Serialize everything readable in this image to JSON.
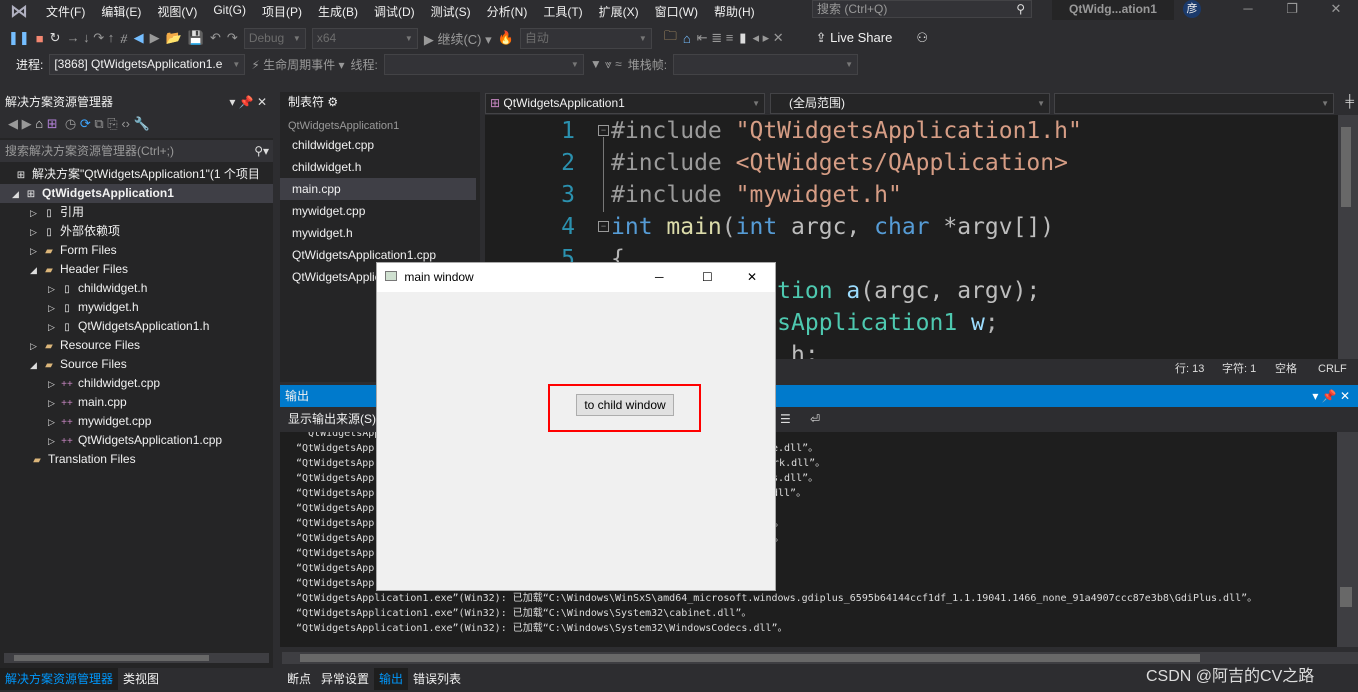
{
  "menu": [
    "文件(F)",
    "编辑(E)",
    "视图(V)",
    "Git(G)",
    "项目(P)",
    "生成(B)",
    "调试(D)",
    "测试(S)",
    "分析(N)",
    "工具(T)",
    "扩展(X)",
    "窗口(W)",
    "帮助(H)"
  ],
  "search_placeholder": "搜索 (Ctrl+Q)",
  "window_title": "QtWidg...ation1",
  "avatar": "彦",
  "toolbar": {
    "config": "Debug",
    "platform": "x64",
    "continue": "继续(C)",
    "auto": "自动",
    "live_share": "Live Share"
  },
  "debugbar": {
    "process_label": "进程:",
    "process": "[3868] QtWidgetsApplication1.e",
    "lifecycle": "生命周期事件",
    "thread_label": "线程:",
    "stack_label": "堆栈帧:"
  },
  "solution": {
    "title": "解决方案资源管理器",
    "search_placeholder": "搜索解决方案资源管理器(Ctrl+;)",
    "items": [
      {
        "label": "解决方案\"QtWidgetsApplication1\"(1 个项目",
        "level": 0,
        "arrow": ""
      },
      {
        "label": "QtWidgetsApplication1",
        "level": 0,
        "arrow": "open",
        "bold": true
      },
      {
        "label": "引用",
        "level": 1,
        "arrow": "closed"
      },
      {
        "label": "外部依赖项",
        "level": 1,
        "arrow": "closed"
      },
      {
        "label": "Form Files",
        "level": 1,
        "arrow": "closed"
      },
      {
        "label": "Header Files",
        "level": 1,
        "arrow": "open"
      },
      {
        "label": "childwidget.h",
        "level": 2,
        "arrow": "closed"
      },
      {
        "label": "mywidget.h",
        "level": 2,
        "arrow": "closed"
      },
      {
        "label": "QtWidgetsApplication1.h",
        "level": 2,
        "arrow": "closed"
      },
      {
        "label": "Resource Files",
        "level": 1,
        "arrow": "closed"
      },
      {
        "label": "Source Files",
        "level": 1,
        "arrow": "open"
      },
      {
        "label": "childwidget.cpp",
        "level": 2,
        "arrow": "closed"
      },
      {
        "label": "main.cpp",
        "level": 2,
        "arrow": "closed"
      },
      {
        "label": "mywidget.cpp",
        "level": 2,
        "arrow": "closed"
      },
      {
        "label": "QtWidgetsApplication1.cpp",
        "level": 2,
        "arrow": "closed"
      },
      {
        "label": "Translation Files",
        "level": 1,
        "arrow": ""
      }
    ]
  },
  "tabnav": {
    "title": "制表符",
    "project": "QtWidgetsApplication1",
    "files": [
      "childwidget.cpp",
      "childwidget.h",
      "main.cpp",
      "mywidget.cpp",
      "mywidget.h",
      "QtWidgetsApplication1.cpp",
      "QtWidgetsApplication1.h"
    ],
    "selected": "main.cpp"
  },
  "editor": {
    "project_dropdown": "QtWidgetsApplication1",
    "scope_dropdown": "(全局范围)",
    "lines": [
      [
        [
          "#include ",
          "pp"
        ],
        [
          "\"QtWidgetsApplication1.h\"",
          "str"
        ]
      ],
      [
        [
          "#include ",
          "pp"
        ],
        [
          "<QtWidgets/QApplication>",
          "str"
        ]
      ],
      [
        [
          "#include ",
          "pp"
        ],
        [
          "\"mywidget.h\"",
          "str"
        ]
      ],
      [
        [
          "int ",
          "kw"
        ],
        [
          "main",
          "fn"
        ],
        [
          "(",
          "p"
        ],
        [
          "int ",
          "kw"
        ],
        [
          "argc, ",
          "id"
        ],
        [
          "char ",
          "kw"
        ],
        [
          "*argv[])",
          "id"
        ]
      ],
      [
        [
          "{",
          "p"
        ]
      ],
      [
        [
          "    QApplication ",
          "ty"
        ],
        [
          "a",
          "var"
        ],
        [
          "(argc, argv);",
          "id"
        ]
      ],
      [
        [
          "    QtWidgetsApplication1 ",
          "ty"
        ],
        [
          "w",
          "var"
        ],
        [
          ";",
          "p"
        ]
      ],
      [
        [
          "             h;",
          "id"
        ]
      ]
    ],
    "status": {
      "line": "行: 13",
      "col": "字符: 1",
      "spaces": "空格",
      "eol": "CRLF"
    }
  },
  "output": {
    "title": "输出",
    "source_label": "显示输出来源(S)",
    "lines": [
      [
        "  QtWidgetsApp",
        ""
      ],
      [
        "“QtWidgetsApp",
        "e.dll”。"
      ],
      [
        "“QtWidgetsApp",
        "work.dll”。"
      ],
      [
        "“QtWidgetsApp",
        "ts.dll”。"
      ],
      [
        "“QtWidgetsApp",
        "dll”。"
      ],
      [
        "“QtWidgetsApp",
        ""
      ],
      [
        "“QtWidgetsApp",
        "。"
      ],
      [
        "“QtWidgetsApp",
        "。"
      ],
      [
        "“QtWidgetsApp",
        ""
      ],
      [
        "“QtWidgetsApp",
        ""
      ],
      [
        "“QtWidgetsApp",
        ""
      ],
      [
        "“QtWidgetsApplication1.exe”(Win32): 已加载“C:\\Windows\\WinSxS\\amd64_microsoft.windows.gdiplus_6595b64144ccf1df_1.1.19041.1466_none_91a4907ccc87e3b8\\GdiPlus.dll”。",
        ""
      ],
      [
        "“QtWidgetsApplication1.exe”(Win32): 已加载“C:\\Windows\\System32\\cabinet.dll”。",
        ""
      ],
      [
        "“QtWidgetsApplication1.exe”(Win32): 已加载“C:\\Windows\\System32\\WindowsCodecs.dll”。",
        ""
      ]
    ]
  },
  "bottom_tabs_left": [
    "解决方案资源管理器",
    "类视图"
  ],
  "bottom_tabs_right": [
    "断点",
    "异常设置",
    "输出",
    "错误列表"
  ],
  "qt_window": {
    "title": "main window",
    "button": "to child window",
    "highlight_color": "#ff0000"
  },
  "watermark": "CSDN @阿吉的CV之路",
  "colors": {
    "accent": "#007acc",
    "keyword": "#569cd6",
    "string": "#d69d85",
    "type": "#4ec9b0",
    "preprocessor": "#9b9b9b",
    "linenumber": "#2b91af"
  }
}
